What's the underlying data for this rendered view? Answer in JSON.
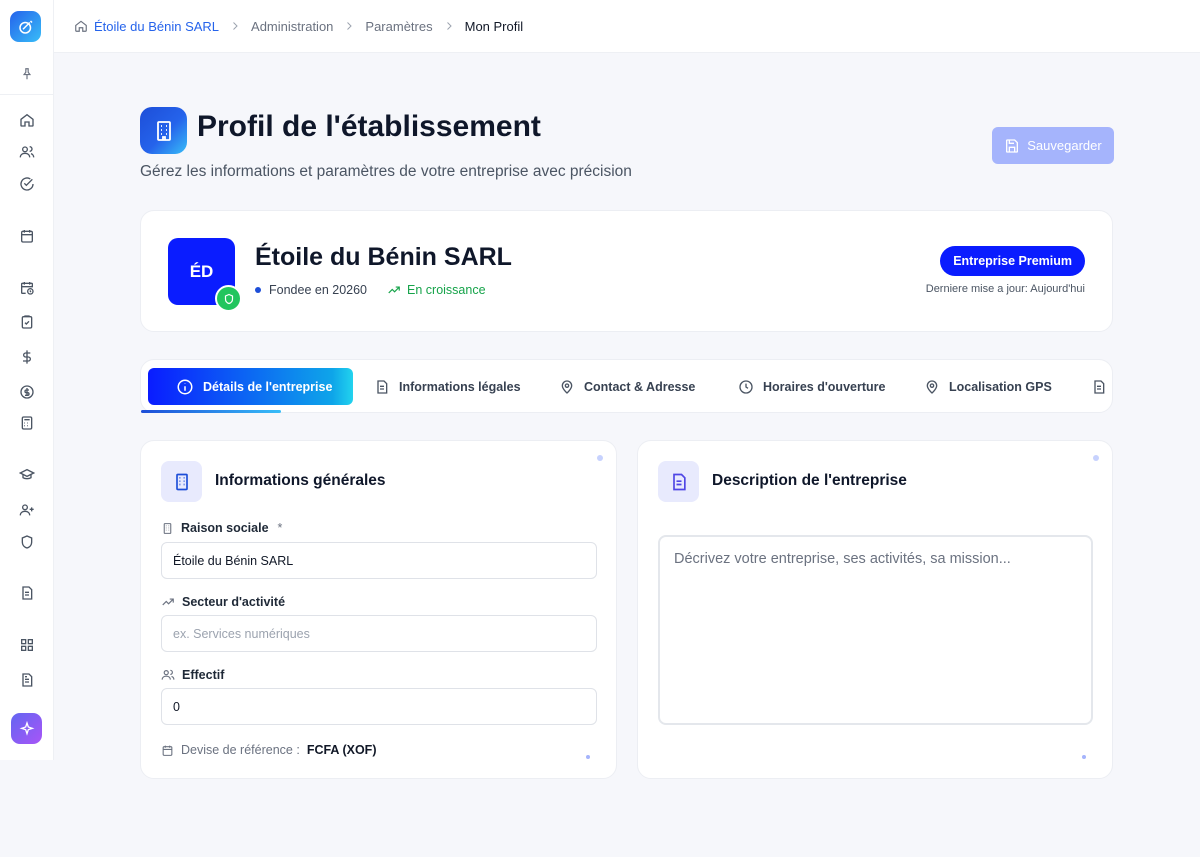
{
  "breadcrumb": [
    "Étoile du Bénin SARL",
    "Administration",
    "Paramètres",
    "Mon Profil"
  ],
  "header": {
    "title": "Profil de l'établissement",
    "subtitle": "Gérez les informations et paramètres de votre entreprise avec précision",
    "save_label": "Sauvegarder"
  },
  "company": {
    "initials": "ÉD",
    "name": "Étoile du Bénin SARL",
    "founded": "Fondee en 20260",
    "growth": "En croissance",
    "badge": "Entreprise Premium",
    "updated": "Derniere mise a jour: Aujourd'hui"
  },
  "tabs": [
    {
      "label": "Détails de l'entreprise",
      "icon": "info-icon",
      "active": true
    },
    {
      "label": "Informations légales",
      "icon": "document-icon"
    },
    {
      "label": "Contact & Adresse",
      "icon": "map-pin-icon"
    },
    {
      "label": "Horaires d'ouverture",
      "icon": "clock-icon"
    },
    {
      "label": "Localisation GPS",
      "icon": "map-pin-icon"
    }
  ],
  "general": {
    "title": "Informations générales",
    "raison_label": "Raison sociale",
    "required_mark": "*",
    "raison_value": "Étoile du Bénin SARL",
    "secteur_label": "Secteur d'activité",
    "secteur_placeholder": "ex. Services numériques",
    "effectif_label": "Effectif",
    "effectif_value": "0",
    "devise_label": "Devise de référence :",
    "devise_value": "FCFA (XOF)"
  },
  "description": {
    "title": "Description de l'entreprise",
    "placeholder": "Décrivez votre entreprise, ses activités, sa mission..."
  },
  "colors": {
    "accent": "#0a1cff",
    "success": "#22c55e",
    "save_button": "#a5b4fc"
  }
}
